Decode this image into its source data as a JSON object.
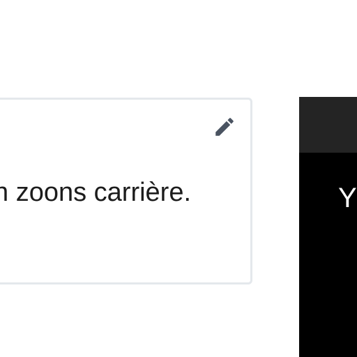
{
  "card": {
    "text": "n zoons carrière.",
    "edit_icon": "pencil-icon",
    "border_color": "#e4e8ec"
  },
  "panel": {
    "text": "Yɔ",
    "background": "#000000",
    "header_background": "#242424"
  }
}
